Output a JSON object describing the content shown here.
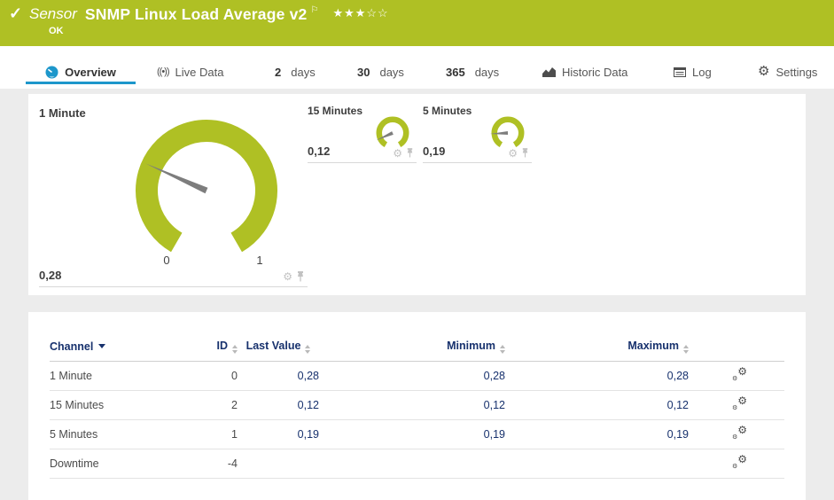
{
  "header": {
    "kind": "Sensor",
    "title": "SNMP Linux Load Average v2",
    "status": "OK",
    "rating": {
      "filled": 3,
      "empty": 2
    }
  },
  "tabs": [
    {
      "label": "Overview",
      "icon": "gauge",
      "active": true
    },
    {
      "label": "Live Data",
      "icon": "broadcast"
    },
    {
      "num": "2",
      "label": "days"
    },
    {
      "num": "30",
      "label": "days"
    },
    {
      "num": "365",
      "label": "days"
    },
    {
      "label": "Historic Data",
      "icon": "chart"
    },
    {
      "label": "Log",
      "icon": "log"
    },
    {
      "label": "Settings",
      "icon": "gear"
    }
  ],
  "gauges": [
    {
      "title": "1 Minute",
      "value": "0,28",
      "value_num": 0.28,
      "scale_min": "0",
      "scale_max": "1"
    },
    {
      "title": "15 Minutes",
      "value": "0,12",
      "value_num": 0.12
    },
    {
      "title": "5 Minutes",
      "value": "0,19",
      "value_num": 0.19
    }
  ],
  "table": {
    "headers": {
      "channel": "Channel",
      "id": "ID",
      "last_value": "Last Value",
      "minimum": "Minimum",
      "maximum": "Maximum"
    },
    "rows": [
      {
        "channel": "1 Minute",
        "id": "0",
        "last": "0,28",
        "min": "0,28",
        "max": "0,28"
      },
      {
        "channel": "15 Minutes",
        "id": "2",
        "last": "0,12",
        "min": "0,12",
        "max": "0,12"
      },
      {
        "channel": "5 Minutes",
        "id": "1",
        "last": "0,19",
        "min": "0,19",
        "max": "0,19"
      },
      {
        "channel": "Downtime",
        "id": "-4",
        "last": "",
        "min": "",
        "max": ""
      }
    ]
  },
  "colors": {
    "status_green": "#afc024",
    "accent_blue": "#1d97cb",
    "navy": "#17316d",
    "needle_gray": "#7d7d7d"
  }
}
